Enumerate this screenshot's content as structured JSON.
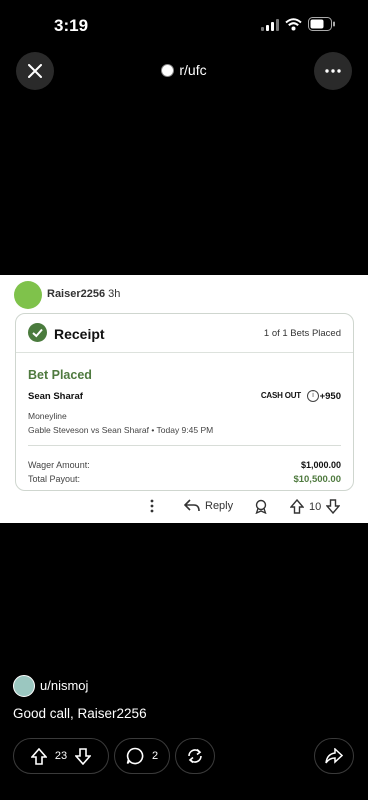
{
  "status_bar": {
    "time": "3:19"
  },
  "nav": {
    "subreddit": "r/ufc"
  },
  "post": {
    "username": "Raiser2256",
    "age": "3h",
    "receipt": {
      "title": "Receipt",
      "bets_count": "1 of 1 Bets Placed",
      "status": "Bet Placed",
      "pick": "Sean Sharaf",
      "cash_out": "CASH OUT",
      "odds": "+950",
      "bet_type": "Moneyline",
      "matchup": "Gable Steveson vs Sean Sharaf • Today 9:45 PM",
      "wager_label": "Wager Amount:",
      "wager_value": "$1,000.00",
      "payout_label": "Total Payout:",
      "payout_value": "$10,500.00"
    },
    "actions": {
      "reply": "Reply",
      "votes": "10"
    }
  },
  "comment": {
    "username": "u/nismoj",
    "body": "Good call, Raiser2256",
    "votes": "23",
    "replies": "2"
  }
}
